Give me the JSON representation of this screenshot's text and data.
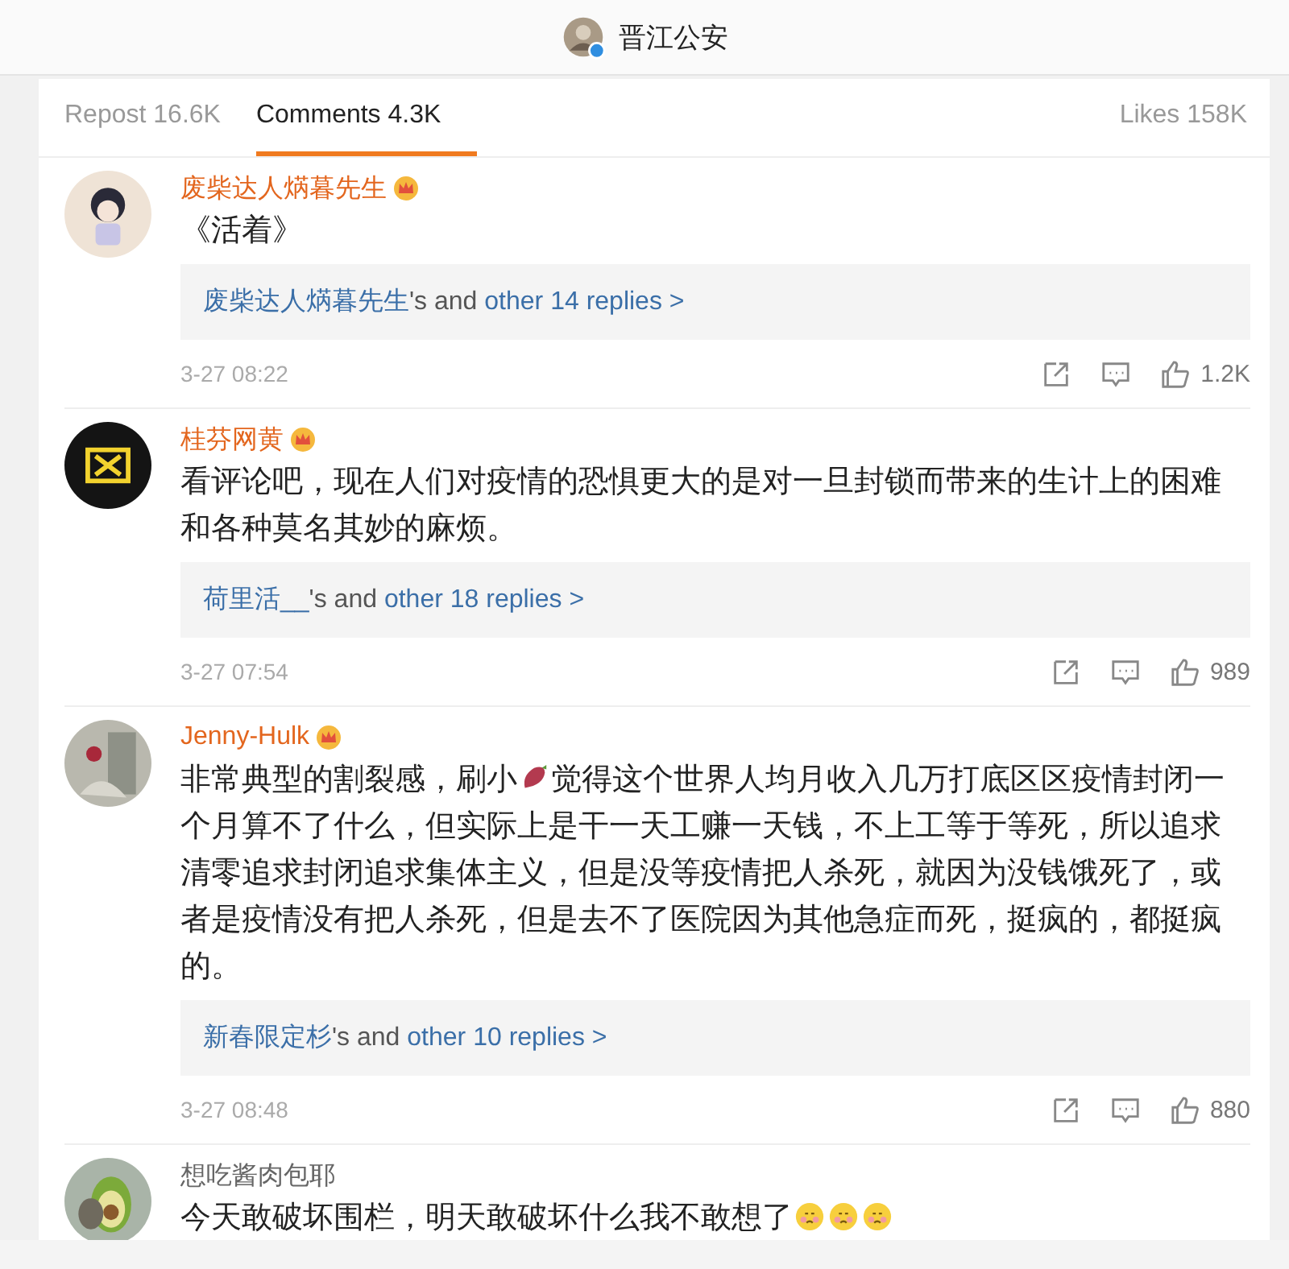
{
  "header": {
    "title": "晋江公安"
  },
  "tabs": [
    {
      "label": "Repost 16.6K",
      "selected": false
    },
    {
      "label": "Comments 4.3K",
      "selected": true
    },
    {
      "label": "Likes 158K",
      "selected": false
    }
  ],
  "comments": [
    {
      "name": "废柴达人焫暮先生",
      "vip": true,
      "body": [
        {
          "kind": "text",
          "text": "《活着》"
        }
      ],
      "reply": {
        "user": "废柴达人焫暮先生",
        "mid": "'s and",
        "more": "other 14 replies >"
      },
      "time": "3-27 08:22",
      "likes": "1.2K"
    },
    {
      "name": "桂芬网黄",
      "vip": true,
      "body": [
        {
          "kind": "text",
          "text": "看评论吧，现在人们对疫情的恐惧更大的是对一旦封锁而带来的生计上的困难和各种莫名其妙的麻烦。"
        }
      ],
      "reply": {
        "user": "荷里活__",
        "mid": "'s and",
        "more": "other 18 replies >"
      },
      "time": "3-27 07:54",
      "likes": "989"
    },
    {
      "name": "Jenny-Hulk",
      "vip": true,
      "body": [
        {
          "kind": "text",
          "text": "非常典型的割裂感，刷小"
        },
        {
          "kind": "emoji"
        },
        {
          "kind": "text",
          "text": "觉得这个世界人均月收入几万打底区区疫情封闭一"
        },
        {
          "kind": "block",
          "text": "个月算不了什么，但实际上是干一天工赚一天钱，不上工等于等死，所以追求清零追求封闭追求集体主义，但是没等疫情把人杀死，就因为没钱饿死了，或者是疫情没有把人杀死，但是去不了医院因为其他急症而死，挺疯的，都挺疯的。"
        }
      ],
      "reply": {
        "user": "新春限定杉",
        "mid": "'s and",
        "more": "other 10 replies >"
      },
      "time": "3-27 08:48",
      "likes": "880"
    },
    {
      "name": "想吃酱肉包耶",
      "vip": false,
      "body": [
        {
          "kind": "text",
          "text": "今天敢破坏围栏，明天敢破坏什么我不敢想了"
        },
        {
          "kind": "face"
        },
        {
          "kind": "face"
        },
        {
          "kind": "face"
        }
      ]
    }
  ]
}
